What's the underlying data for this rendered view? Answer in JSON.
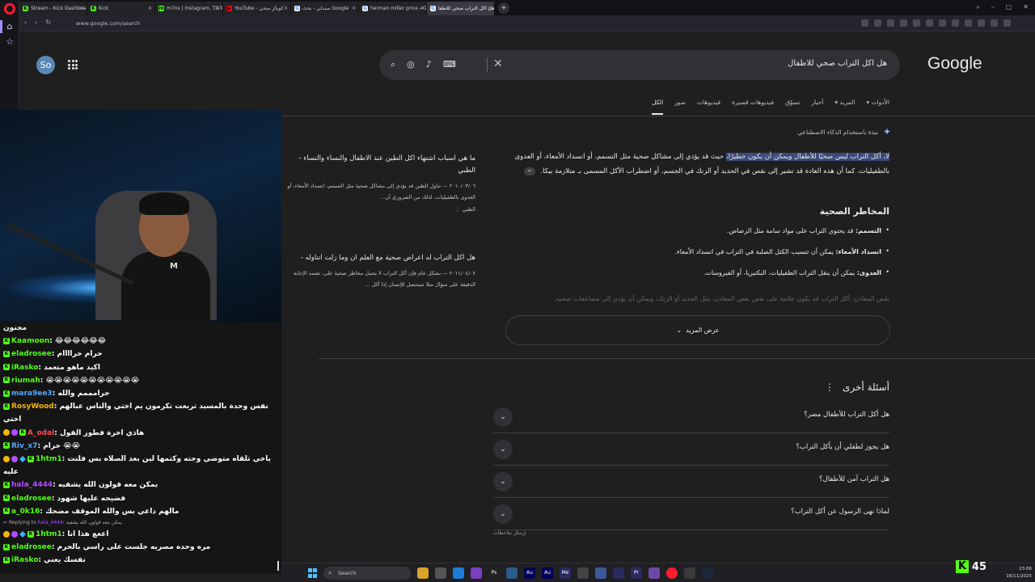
{
  "browser": {
    "tabs": [
      {
        "title": "Stream - Kick Dashboard",
        "fav": "K",
        "color": "#53fc18"
      },
      {
        "title": "Kick",
        "fav": "K",
        "color": "#53fc18"
      },
      {
        "title": "m7ns | Instagram, TikTok |",
        "fav": "m",
        "color": "#53fc18"
      },
      {
        "title": "YouTube - كويكز صحي",
        "fav": "▶",
        "color": "#ff0000"
      },
      {
        "title": "صيدلي - بحث Google",
        "fav": "G",
        "color": "#ffffff"
      },
      {
        "title": "herman miller price - Goo",
        "fav": "G",
        "color": "#ffffff"
      },
      {
        "title": "هل اكل التراب صحي للاطفا",
        "fav": "G",
        "color": "#ffffff",
        "active": true
      }
    ],
    "url": "www.google.com/search"
  },
  "google": {
    "avatar": "So",
    "logo": "Google",
    "query": "هل اكل التراب صحي للاطفال",
    "filters": [
      {
        "label": "الكل",
        "active": true
      },
      {
        "label": "صور"
      },
      {
        "label": "فيديوهات"
      },
      {
        "label": "فيديوهات قصيرة"
      },
      {
        "label": "تسوّق"
      },
      {
        "label": "أخبار"
      },
      {
        "label": "المزيد ▾"
      },
      {
        "label": "الأدوات ▾"
      }
    ],
    "ai_label": "نبذة باستخدام الذكاء الاصطناعي",
    "ai_highlight": "لا، أكل التراب ليس صحيًا للأطفال ويمكن أن يكون خطيرًا،",
    "ai_rest": " حيث قد يؤدي إلى مشاكل صحية مثل التسمم، أو انسداد الأمعاء، أو العدوى بالطفيليات. كما أن هذه العادة قد تشير إلى نقص في الحديد أو الزنك في الجسم، أو اضطراب الأكل المسمى بـ متلازمة بيكا.",
    "risks_title": "المخاطر الصحية",
    "risks": [
      {
        "k": "التسمم:",
        "v": " قد يحتوي التراب على مواد سامة مثل الرصاص."
      },
      {
        "k": "انسداد الأمعاء:",
        "v": " يمكن أن تتسبب الكتل الصلبة في التراب في انسداد الأمعاء."
      },
      {
        "k": "العدوى:",
        "v": " يمكن أن ينقل التراب الطفيليات، البكتيريا، أو الفيروسات."
      }
    ],
    "fade_line": "نقص المعادن: أكل التراب قد يكون علامة على نقص بعض المعادن، مثل الحديد أو الزنك، ويمكن أن يؤدي إلى مضاعفات صحية.",
    "show_more": "عرض المزيد",
    "sources": [
      {
        "title": "ما هي اسباب اشتهاء اكل الطين عند الاطفال والنساء والنساء - الطبي",
        "desc": "٢٠١٠/٠٣/٠٦ — تناول الطين قد يؤدي إلى مشاكل صحية مثل التسمم، انسداد الأمعاء، أو العدوى بالطفيليات، لذلك من الضروري أن...",
        "site": "الطبي"
      },
      {
        "title": "هل اكل التراب له اعراض صحية مع العلم ان وما زلت اتناوله -",
        "desc": "٢٠١١/٠٤/٠٧ — بشكل عام فإن أكل التراب لا يحمل مخاطر صحية على، تعتمد الإجابة الدقيقة على سؤال مثلا سيحصل للإنسان إذا أكل ...",
        "site": ""
      }
    ],
    "paa_title": "أسئلة أخرى",
    "paa": [
      "هل أكل التراب للأطفال مضر؟",
      "هل يجوز لطفلي أن يأكل التراب؟",
      "هل التراب آمن للأطفال؟",
      "لماذا نهى الرسول عن أكل التراب؟"
    ],
    "feedback": "إرسال ملاحظات"
  },
  "chat": {
    "messages": [
      {
        "user": "",
        "text": "مجنون",
        "color": "#fff",
        "badges": []
      },
      {
        "user": "Kaamoon",
        "text": "😂😂😂😂😂😂",
        "color": "#53fc18",
        "badges": [
          "k"
        ]
      },
      {
        "user": "eladrosee",
        "text": "حرام حراااام",
        "color": "#53fc18",
        "badges": [
          "k"
        ]
      },
      {
        "user": "iRasko",
        "text": "اكيد ماهو متعمد",
        "color": "#53fc18",
        "badges": [
          "k"
        ]
      },
      {
        "user": "riumah",
        "text": "😭😭😭😭😭😭😭😭😭😭😭",
        "color": "#53fc18",
        "badges": [
          "k"
        ]
      },
      {
        "user": "mara9ee3",
        "text": "حرامممم والله",
        "color": "#53a9ff",
        "badges": [
          "k"
        ]
      },
      {
        "user": "RosyWood",
        "text": "نفس وحدة بالمسيد تربعت تكرمون يم اختي والناس عبالهم اختي",
        "color": "#f6b500",
        "badges": [
          "k"
        ],
        "wrap": true
      },
      {
        "user": "A_odal",
        "text": "هاذي اخرة فطور الفول",
        "color": "#ff4d4d",
        "badges": [
          "g",
          "p",
          "k"
        ]
      },
      {
        "user": "Riv_x7",
        "text": "حرام 😭😭",
        "color": "#53a9ff",
        "badges": [
          "k"
        ]
      },
      {
        "user": "1htm1",
        "text": "ياخي تلقاه متوضي وجته وكتمها لين بعد الصلاه بس فلتت عليه",
        "color": "#53fc18",
        "badges": [
          "g",
          "p",
          "d",
          "k"
        ],
        "wrap": true
      },
      {
        "user": "hala_4444",
        "text": "يمكن معه قولون الله يشفيه",
        "color": "#b04cff",
        "badges": [
          "k"
        ]
      },
      {
        "user": "eladrosee",
        "text": "فضيحه عليها شهود",
        "color": "#53fc18",
        "badges": [
          "k"
        ]
      },
      {
        "user": "a_0k16",
        "text": "مالهم داعي بس والله الموقف مضحك",
        "color": "#53fc18",
        "badges": [
          "k"
        ]
      },
      {
        "reply_to": "hala_4444",
        "reply_text": "يمكن معه قولون الله يشفيه",
        "reply_prefix": "Replying to"
      },
      {
        "user": "1htm1",
        "text": "اععع هذا انا",
        "color": "#53fc18",
        "badges": [
          "g",
          "p",
          "d",
          "k"
        ]
      },
      {
        "user": "eladrosee",
        "text": "مره وحده مصريه جلست على راسي بالحرم",
        "color": "#53fc18",
        "badges": [
          "k"
        ]
      },
      {
        "user": "iRasko",
        "text": "نفسك يعني",
        "color": "#53fc18",
        "badges": [
          "k"
        ]
      }
    ]
  },
  "taskbar": {
    "search_placeholder": "Search",
    "time": "23:06",
    "date": "16/11/2025",
    "viewer_count": "45"
  }
}
